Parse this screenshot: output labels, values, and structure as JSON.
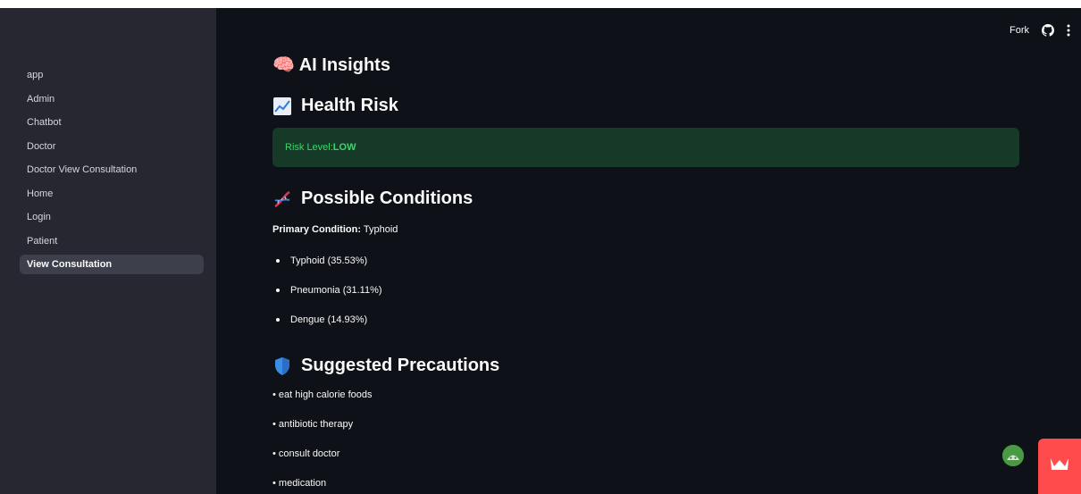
{
  "sidebar": {
    "items": [
      {
        "label": "app",
        "active": false
      },
      {
        "label": "Admin",
        "active": false
      },
      {
        "label": "Chatbot",
        "active": false
      },
      {
        "label": "Doctor",
        "active": false
      },
      {
        "label": "Doctor View Consultation",
        "active": false
      },
      {
        "label": "Home",
        "active": false
      },
      {
        "label": "Login",
        "active": false
      },
      {
        "label": "Patient",
        "active": false
      },
      {
        "label": "View Consultation",
        "active": true
      }
    ]
  },
  "topbar": {
    "fork_label": "Fork",
    "github_icon": "github-icon",
    "menu_icon": "kebab-menu-icon"
  },
  "main": {
    "title": "🧠 AI Insights",
    "health_risk": {
      "heading": "Health Risk",
      "icon": "chart-increasing-icon"
    },
    "risk_alert": {
      "prefix": "Risk Level: ",
      "value": "LOW"
    },
    "conditions": {
      "heading": "Possible Conditions",
      "icon": "dna-icon",
      "primary_label": "Primary Condition:",
      "primary_value": " Typhoid",
      "items": [
        "Typhoid (35.53%)",
        "Pneumonia (31.11%)",
        "Dengue (14.93%)"
      ]
    },
    "precautions": {
      "heading": "Suggested Precautions",
      "icon": "shield-icon",
      "items": [
        "• eat high calorie foods",
        "• antibiotic therapy",
        "• consult doctor",
        "• medication"
      ]
    }
  },
  "colors": {
    "background": "#0e1117",
    "sidebar": "#262730",
    "success_bg": "#173928",
    "success_text": "#3dd56d",
    "accent_red": "#ff4b4b"
  }
}
